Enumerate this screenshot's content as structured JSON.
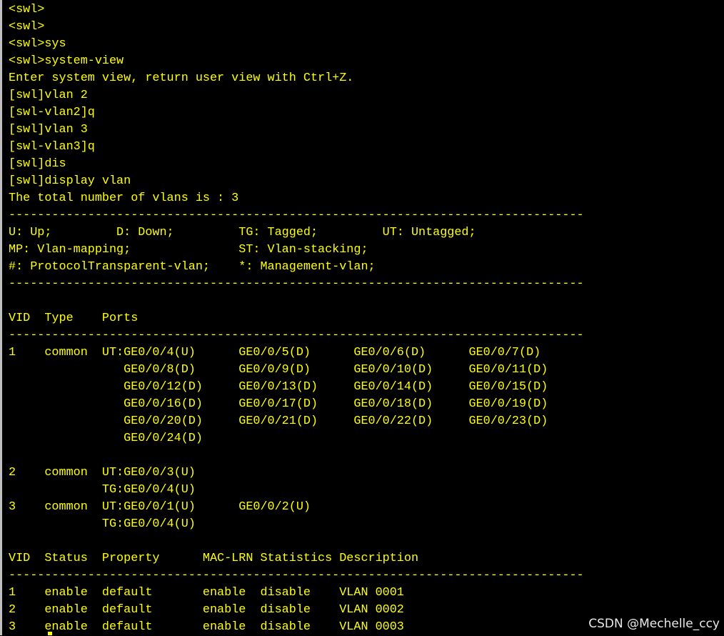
{
  "terminal": {
    "text_color": "#ffff00",
    "background": "#000000",
    "lines": [
      "<swl>",
      "<swl>",
      "<swl>sys",
      "<swl>system-view",
      "Enter system view, return user view with Ctrl+Z.",
      "[swl]vlan 2",
      "[swl-vlan2]q",
      "[swl]vlan 3",
      "[swl-vlan3]q",
      "[swl]dis",
      "[swl]display vlan",
      "The total number of vlans is : 3",
      "--------------------------------------------------------------------------------",
      "U: Up;         D: Down;         TG: Tagged;         UT: Untagged;",
      "MP: Vlan-mapping;               ST: Vlan-stacking;",
      "#: ProtocolTransparent-vlan;    *: Management-vlan;",
      "--------------------------------------------------------------------------------",
      "",
      "VID  Type    Ports",
      "--------------------------------------------------------------------------------",
      "1    common  UT:GE0/0/4(U)      GE0/0/5(D)      GE0/0/6(D)      GE0/0/7(D)",
      "                GE0/0/8(D)      GE0/0/9(D)      GE0/0/10(D)     GE0/0/11(D)",
      "                GE0/0/12(D)     GE0/0/13(D)     GE0/0/14(D)     GE0/0/15(D)",
      "                GE0/0/16(D)     GE0/0/17(D)     GE0/0/18(D)     GE0/0/19(D)",
      "                GE0/0/20(D)     GE0/0/21(D)     GE0/0/22(D)     GE0/0/23(D)",
      "                GE0/0/24(D)",
      "",
      "2    common  UT:GE0/0/3(U)",
      "             TG:GE0/0/4(U)",
      "3    common  UT:GE0/0/1(U)      GE0/0/2(U)",
      "             TG:GE0/0/4(U)",
      "",
      "VID  Status  Property      MAC-LRN Statistics Description",
      "--------------------------------------------------------------------------------",
      "1    enable  default       enable  disable    VLAN 0001",
      "2    enable  default       enable  disable    VLAN 0002",
      "3    enable  default       enable  disable    VLAN 0003"
    ]
  },
  "watermark": {
    "text": "CSDN @Mechelle_ccy"
  }
}
